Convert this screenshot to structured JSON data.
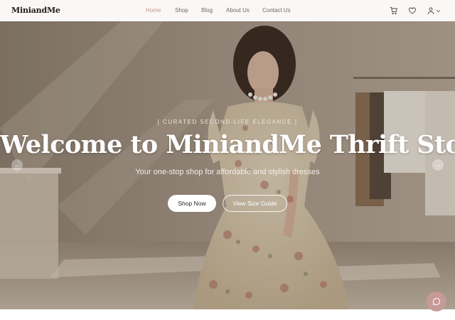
{
  "header": {
    "logo": "MiniandMe",
    "nav": [
      {
        "label": "Home",
        "active": true
      },
      {
        "label": "Shop",
        "active": false
      },
      {
        "label": "Blog",
        "active": false
      },
      {
        "label": "About Us",
        "active": false
      },
      {
        "label": "Contact Us",
        "active": false
      }
    ],
    "icons": [
      "cart-icon",
      "heart-icon",
      "user-icon",
      "chevron-down-icon"
    ]
  },
  "hero": {
    "eyebrow": "[ CURATED SECOND-LIFE ELEGANCE ]",
    "headline": "Welcome to MiniandMe Thrift Store",
    "subheadline": "Your one-stop shop for affordable and stylish dresses",
    "primary_button": "Shop Now",
    "secondary_button": "View Size Guide",
    "prev_icon": "arrow-left-icon",
    "next_icon": "arrow-right-icon"
  },
  "chat": {
    "icon": "chat-icon"
  },
  "colors": {
    "accent": "#c98f8f",
    "chat_button": "#c79a9a",
    "header_bg": "#faf8f6"
  }
}
